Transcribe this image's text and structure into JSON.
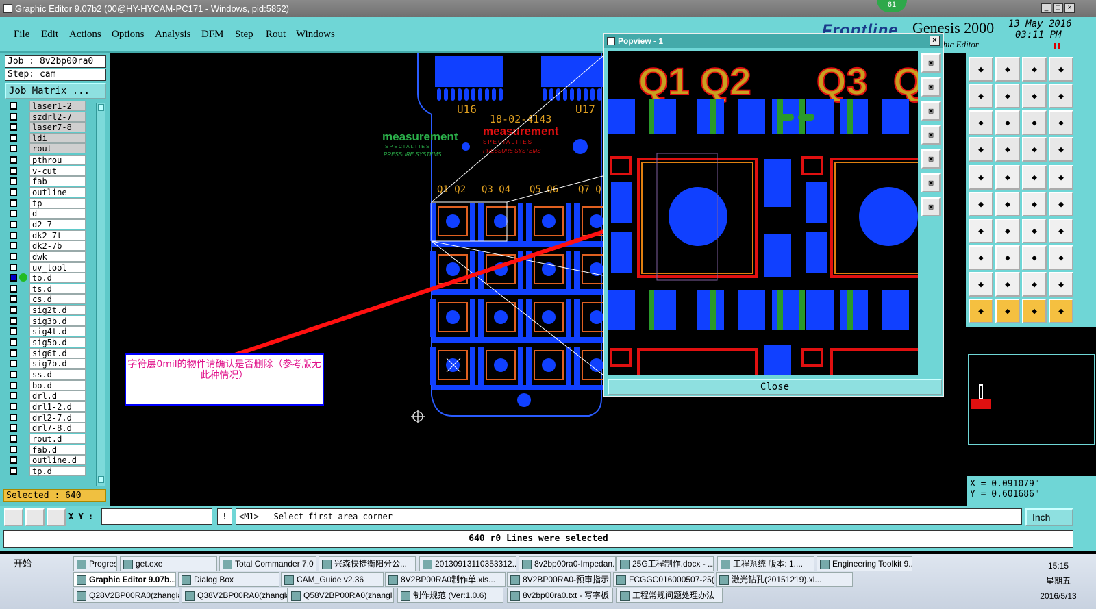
{
  "window": {
    "title": "Graphic Editor 9.07b2 (00@HY-HYCAM-PC171 - Windows, pid:5852)",
    "badge": "61"
  },
  "menu": [
    "File",
    "Edit",
    "Actions",
    "Options",
    "Analysis",
    "DFM",
    "Step",
    "Rout",
    "Windows"
  ],
  "brand": {
    "name": "Genesis 2000",
    "sub": "phic Editor",
    "logo": "Frontline",
    "date": "13 May 2016",
    "time": "03:11 PM"
  },
  "job": {
    "job": "Job : 8v2bp00ra0",
    "step": "Step: cam",
    "matrix": "Job Matrix ..."
  },
  "layers_top": [
    "laser1-2",
    "szdrl2-7",
    "laser7-8",
    "ldi",
    "rout"
  ],
  "layers": [
    "pthrou",
    "v-cut",
    "fab",
    "outline",
    "tp",
    "d",
    "d2-7",
    "dk2-7t",
    "dk2-7b",
    "dwk",
    "uv_tool",
    "to.d",
    "ts.d",
    "cs.d",
    "sig2t.d",
    "sig3b.d",
    "sig4t.d",
    "sig5b.d",
    "sig6t.d",
    "sig7b.d",
    "ss.d",
    "bo.d",
    "drl.d",
    "drl1-2.d",
    "drl2-7.d",
    "drl7-8.d",
    "rout.d",
    "fab.d",
    "outline.d",
    "tp.d"
  ],
  "selected": "Selected : 640",
  "board": {
    "u16": "U16",
    "u17": "U17",
    "part": "18-02-4143",
    "logo1": "measurement",
    "logo1b": "SPECIALTIES",
    "logo1c": "PRESSURE SYSTEMS",
    "q_labels": [
      "Q1 Q2",
      "Q3 Q4",
      "Q5 Q6",
      "Q7 Q"
    ]
  },
  "note": "字符层0mil的物件请确认是否删除（参考版无此种情况）",
  "popview": {
    "title": "Popview - 1",
    "labels": [
      "Q1",
      "Q2",
      "Q3",
      "Q"
    ],
    "close": "Close"
  },
  "coords": {
    "x": "X = 0.091079\"",
    "y": "Y = 0.601686\""
  },
  "xy_label": "X Y :",
  "prompt": "<M1> - Select first area corner",
  "unit": "Inch",
  "status": "640 r0 Lines were selected",
  "taskbar": {
    "start": "开始",
    "row1": [
      "Progress",
      "get.exe",
      "Total Commander 7.0 ...",
      "兴森快捷衡阳分公...",
      "20130913110353312....",
      "8v2bp00ra0-Impedan...",
      "25G工程制作.docx - ...",
      "工程系统  版本: 1....",
      "Engineering Toolkit 9...."
    ],
    "row2": [
      "Graphic Editor 9.07b...",
      "Dialog Box",
      "CAM_Guide v2.36",
      "8V2BP00RA0制作单.xls...",
      "8V2BP00RA0-预审指示...",
      "FCGGC016000507-25(8...",
      "激光钻孔(20151219).xl..."
    ],
    "row3": [
      "Q28V2BP00RA0(zhangla",
      "Q38V2BP00RA0(zhangla",
      "Q58V2BP00RA0(zhangla",
      "制作规范 (Ver:1.0.6)",
      "8v2bp00ra0.txt - 写字板",
      "工程常规问题处理办法"
    ],
    "time": "15:15",
    "weekday": "星期五",
    "date": "2016/5/13"
  }
}
